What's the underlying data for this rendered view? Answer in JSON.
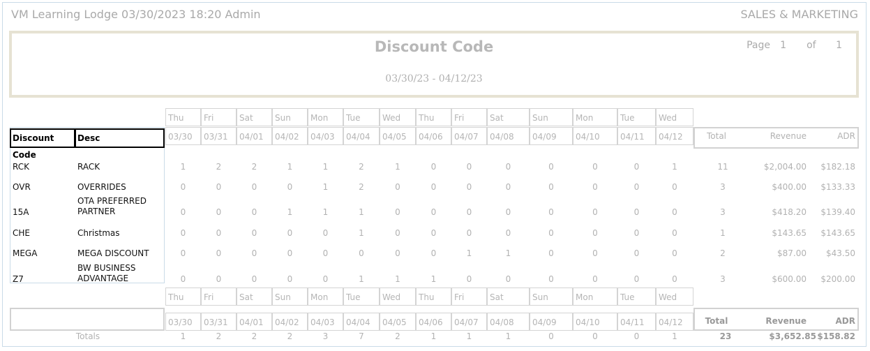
{
  "header": {
    "app_line": "VM Learning Lodge 03/30/2023 18:20  Admin",
    "department": "SALES & MARKETING"
  },
  "report": {
    "title": "Discount Code",
    "date_range": "03/30/23 - 04/12/23",
    "page_label": "Page",
    "page_num": "1",
    "of_label": "of",
    "page_total": "1"
  },
  "days": [
    "Thu",
    "Fri",
    "Sat",
    "Sun",
    "Mon",
    "Tue",
    "Wed",
    "Thu",
    "Fri",
    "Sat",
    "Sun",
    "Mon",
    "Tue",
    "Wed"
  ],
  "dates": [
    "03/30",
    "03/31",
    "04/01",
    "04/02",
    "04/03",
    "04/04",
    "04/05",
    "04/06",
    "04/07",
    "04/08",
    "04/09",
    "04/10",
    "04/11",
    "04/12"
  ],
  "columns": {
    "code": "Discount Code",
    "desc": "Desc",
    "total": "Total",
    "revenue": "Revenue",
    "adr": "ADR"
  },
  "rows": [
    {
      "code": "RCK",
      "desc": "RACK",
      "counts": [
        "1",
        "2",
        "2",
        "1",
        "1",
        "2",
        "1",
        "0",
        "0",
        "0",
        "0",
        "0",
        "0",
        "1"
      ],
      "total": "11",
      "revenue": "$2,004.00",
      "adr": "$182.18"
    },
    {
      "code": "OVR",
      "desc": "OVERRIDES",
      "counts": [
        "0",
        "0",
        "0",
        "0",
        "1",
        "2",
        "0",
        "0",
        "0",
        "0",
        "0",
        "0",
        "0",
        "0"
      ],
      "total": "3",
      "revenue": "$400.00",
      "adr": "$133.33"
    },
    {
      "code": "15A",
      "desc": "OTA PREFERRED PARTNER",
      "counts": [
        "0",
        "0",
        "0",
        "1",
        "1",
        "1",
        "0",
        "0",
        "0",
        "0",
        "0",
        "0",
        "0",
        "0"
      ],
      "total": "3",
      "revenue": "$418.20",
      "adr": "$139.40"
    },
    {
      "code": "CHE",
      "desc": "Christmas",
      "counts": [
        "0",
        "0",
        "0",
        "0",
        "0",
        "1",
        "0",
        "0",
        "0",
        "0",
        "0",
        "0",
        "0",
        "0"
      ],
      "total": "1",
      "revenue": "$143.65",
      "adr": "$143.65"
    },
    {
      "code": "MEGA",
      "desc": "MEGA DISCOUNT",
      "counts": [
        "0",
        "0",
        "0",
        "0",
        "0",
        "0",
        "0",
        "0",
        "1",
        "1",
        "0",
        "0",
        "0",
        "0"
      ],
      "total": "2",
      "revenue": "$87.00",
      "adr": "$43.50"
    },
    {
      "code": "Z7",
      "desc": "BW BUSINESS ADVANTAGE",
      "counts": [
        "0",
        "0",
        "0",
        "0",
        "0",
        "1",
        "1",
        "1",
        "0",
        "0",
        "0",
        "0",
        "0",
        "0"
      ],
      "total": "3",
      "revenue": "$600.00",
      "adr": "$200.00"
    }
  ],
  "totals": {
    "label": "Totals",
    "counts": [
      "1",
      "2",
      "2",
      "2",
      "3",
      "7",
      "2",
      "1",
      "1",
      "1",
      "0",
      "0",
      "0",
      "1"
    ],
    "total": "23",
    "revenue": "$3,652.85",
    "adr": "$158.82"
  }
}
